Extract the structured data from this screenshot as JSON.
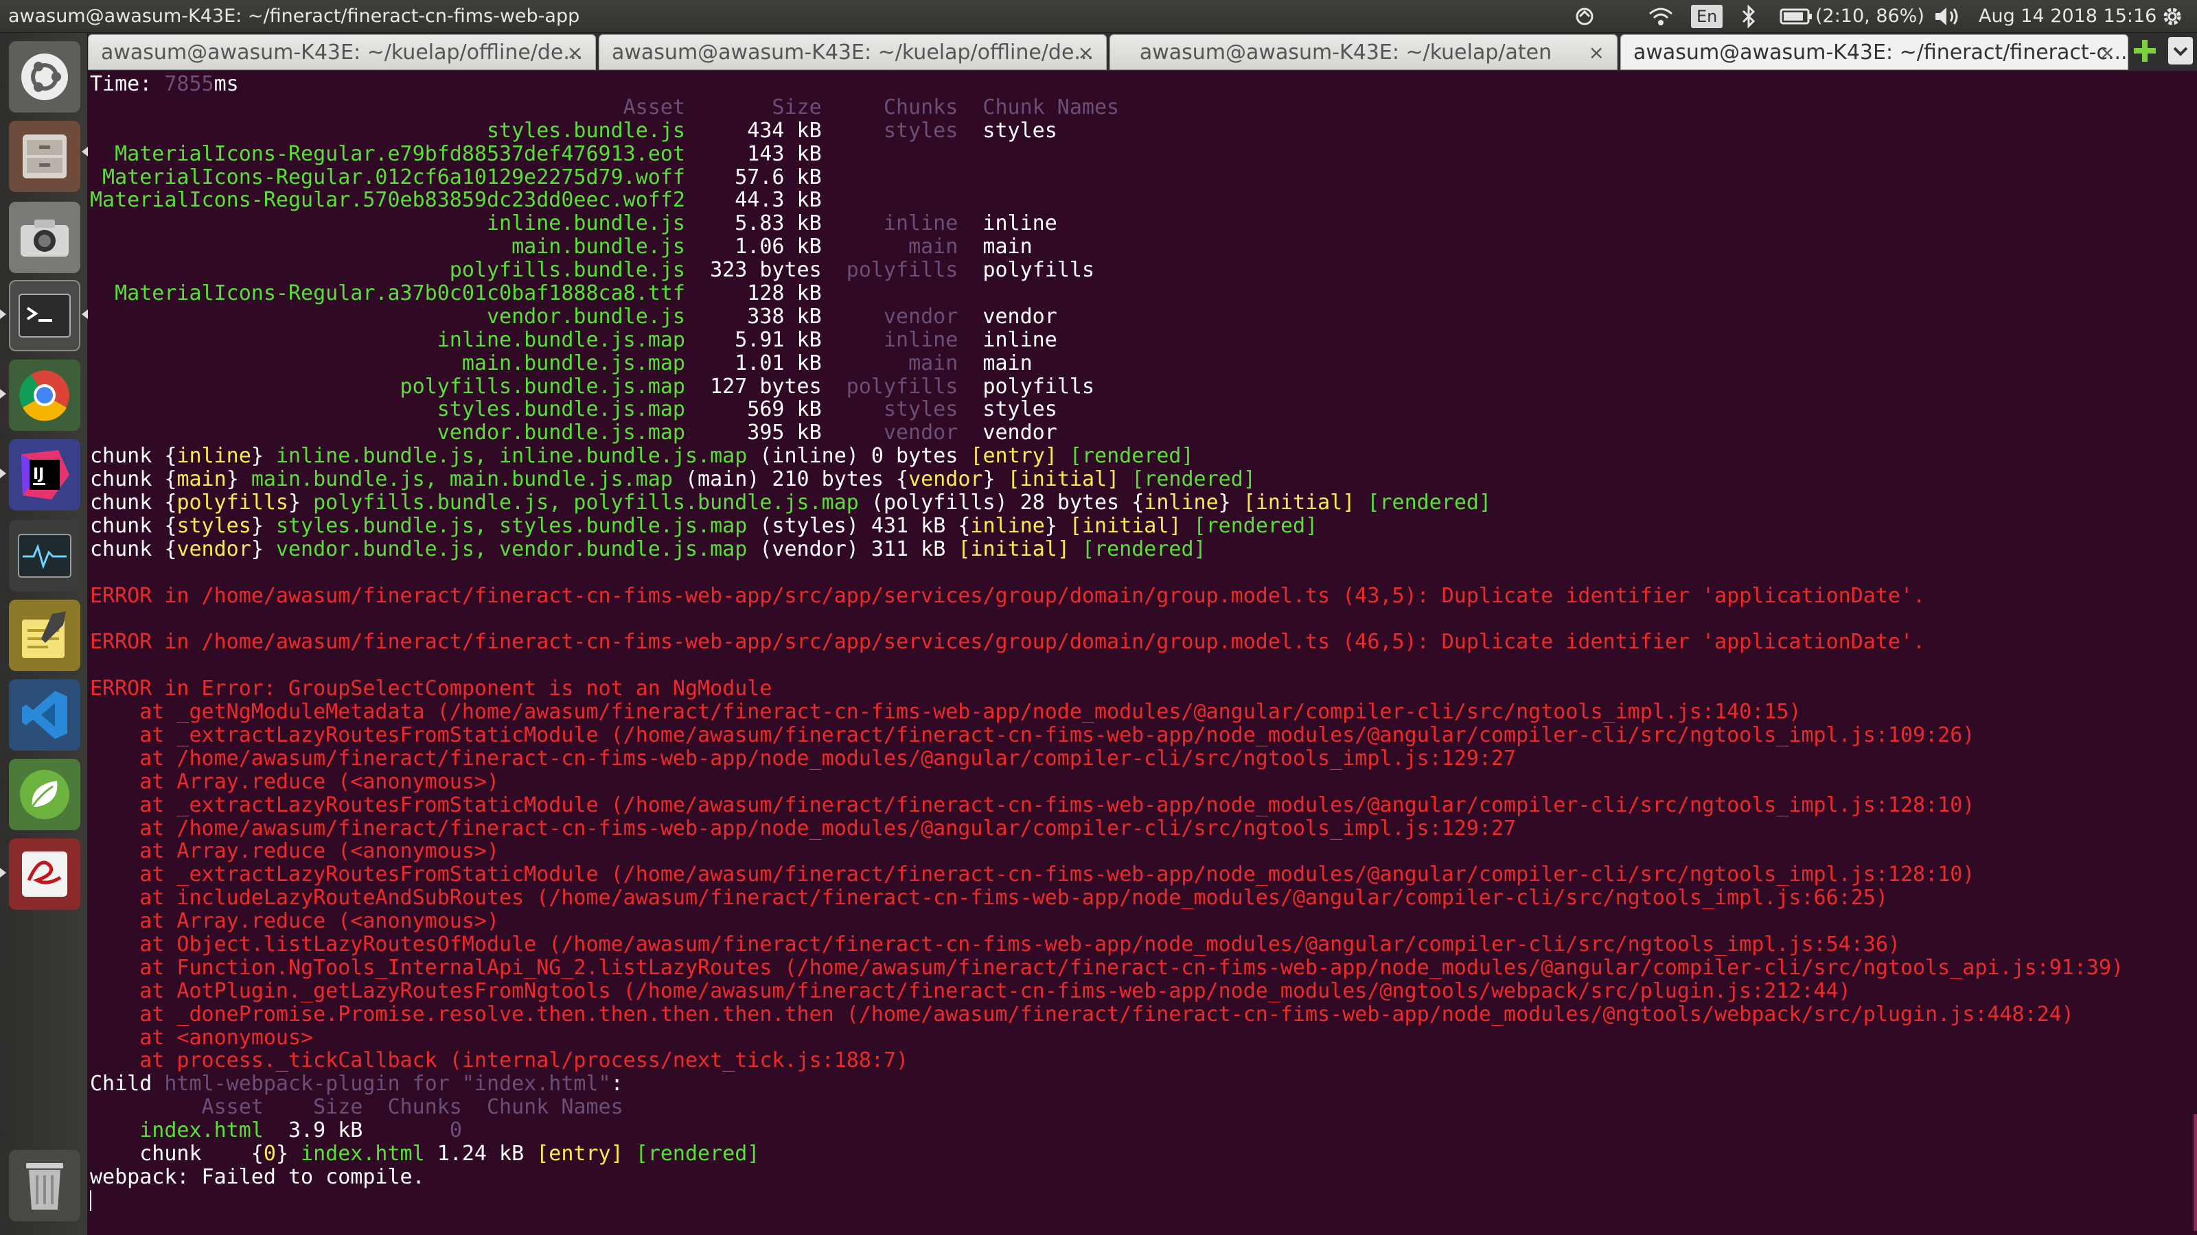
{
  "topbar": {
    "window_title": "awasum@awasum-K43E: ~/fineract/fineract-cn-fims-web-app",
    "keyboard": "En",
    "battery": "(2:10, 86%)",
    "datetime": "Aug 14 2018 15:16"
  },
  "launcher": {
    "items": [
      "ubuntu-dash",
      "files",
      "camera",
      "terminal",
      "chrome",
      "intellij-idea",
      "system-monitor",
      "text-editor",
      "vscode",
      "spring-tool-suite",
      "reader",
      "trash"
    ]
  },
  "tabs": [
    {
      "label": "awasum@awasum-K43E: ~/kuelap/offline/de..."
    },
    {
      "label": "awasum@awasum-K43E: ~/kuelap/offline/de..."
    },
    {
      "label": "awasum@awasum-K43E: ~/kuelap/aten"
    },
    {
      "label": "awasum@awasum-K43E: ~/fineract/fineract-c..."
    }
  ],
  "terminal": {
    "lines": [
      [
        [
          "w",
          "Time: "
        ],
        [
          "dim",
          "7855"
        ],
        [
          "w",
          "ms"
        ]
      ],
      [
        [
          "dim",
          "                                           Asset       Size     Chunks  Chunk Names"
        ]
      ],
      [
        [
          "g",
          "                                styles.bundle.js"
        ],
        [
          "w",
          "     434 kB     "
        ],
        [
          "dim",
          "styles"
        ],
        [
          "w",
          "  styles"
        ]
      ],
      [
        [
          "g",
          "  MaterialIcons-Regular.e79bfd88537def476913.eot"
        ],
        [
          "w",
          "     143 kB"
        ]
      ],
      [
        [
          "g",
          " MaterialIcons-Regular.012cf6a10129e2275d79.woff"
        ],
        [
          "w",
          "    57.6 kB"
        ]
      ],
      [
        [
          "g",
          "MaterialIcons-Regular.570eb83859dc23dd0eec.woff2"
        ],
        [
          "w",
          "    44.3 kB"
        ]
      ],
      [
        [
          "g",
          "                                inline.bundle.js"
        ],
        [
          "w",
          "    5.83 kB     "
        ],
        [
          "dim",
          "inline"
        ],
        [
          "w",
          "  inline"
        ]
      ],
      [
        [
          "g",
          "                                  main.bundle.js"
        ],
        [
          "w",
          "    1.06 kB       "
        ],
        [
          "dim",
          "main"
        ],
        [
          "w",
          "  main"
        ]
      ],
      [
        [
          "g",
          "                             polyfills.bundle.js"
        ],
        [
          "w",
          "  323 bytes  "
        ],
        [
          "dim",
          "polyfills"
        ],
        [
          "w",
          "  polyfills"
        ]
      ],
      [
        [
          "g",
          "  MaterialIcons-Regular.a37b0c01c0baf1888ca8.ttf"
        ],
        [
          "w",
          "     128 kB"
        ]
      ],
      [
        [
          "g",
          "                                vendor.bundle.js"
        ],
        [
          "w",
          "     338 kB     "
        ],
        [
          "dim",
          "vendor"
        ],
        [
          "w",
          "  vendor"
        ]
      ],
      [
        [
          "g",
          "                            inline.bundle.js.map"
        ],
        [
          "w",
          "    5.91 kB     "
        ],
        [
          "dim",
          "inline"
        ],
        [
          "w",
          "  inline"
        ]
      ],
      [
        [
          "g",
          "                              main.bundle.js.map"
        ],
        [
          "w",
          "    1.01 kB       "
        ],
        [
          "dim",
          "main"
        ],
        [
          "w",
          "  main"
        ]
      ],
      [
        [
          "g",
          "                         polyfills.bundle.js.map"
        ],
        [
          "w",
          "  127 bytes  "
        ],
        [
          "dim",
          "polyfills"
        ],
        [
          "w",
          "  polyfills"
        ]
      ],
      [
        [
          "g",
          "                            styles.bundle.js.map"
        ],
        [
          "w",
          "     569 kB     "
        ],
        [
          "dim",
          "styles"
        ],
        [
          "w",
          "  styles"
        ]
      ],
      [
        [
          "g",
          "                            vendor.bundle.js.map"
        ],
        [
          "w",
          "     395 kB     "
        ],
        [
          "dim",
          "vendor"
        ],
        [
          "w",
          "  vendor"
        ]
      ],
      [
        [
          "w",
          "chunk {"
        ],
        [
          "y",
          "inline"
        ],
        [
          "w",
          "} "
        ],
        [
          "g",
          "inline.bundle.js, inline.bundle.js.map"
        ],
        [
          "w",
          " (inline) 0 bytes "
        ],
        [
          "y",
          "[entry]"
        ],
        [
          "w",
          " "
        ],
        [
          "g",
          "[rendered]"
        ]
      ],
      [
        [
          "w",
          "chunk {"
        ],
        [
          "y",
          "main"
        ],
        [
          "w",
          "} "
        ],
        [
          "g",
          "main.bundle.js, main.bundle.js.map"
        ],
        [
          "w",
          " (main) 210 bytes {"
        ],
        [
          "y",
          "vendor"
        ],
        [
          "w",
          "} "
        ],
        [
          "y",
          "[initial]"
        ],
        [
          "w",
          " "
        ],
        [
          "g",
          "[rendered]"
        ]
      ],
      [
        [
          "w",
          "chunk {"
        ],
        [
          "y",
          "polyfills"
        ],
        [
          "w",
          "} "
        ],
        [
          "g",
          "polyfills.bundle.js, polyfills.bundle.js.map"
        ],
        [
          "w",
          " (polyfills) 28 bytes {"
        ],
        [
          "y",
          "inline"
        ],
        [
          "w",
          "} "
        ],
        [
          "y",
          "[initial]"
        ],
        [
          "w",
          " "
        ],
        [
          "g",
          "[rendered]"
        ]
      ],
      [
        [
          "w",
          "chunk {"
        ],
        [
          "y",
          "styles"
        ],
        [
          "w",
          "} "
        ],
        [
          "g",
          "styles.bundle.js, styles.bundle.js.map"
        ],
        [
          "w",
          " (styles) 431 kB {"
        ],
        [
          "y",
          "inline"
        ],
        [
          "w",
          "} "
        ],
        [
          "y",
          "[initial]"
        ],
        [
          "w",
          " "
        ],
        [
          "g",
          "[rendered]"
        ]
      ],
      [
        [
          "w",
          "chunk {"
        ],
        [
          "y",
          "vendor"
        ],
        [
          "w",
          "} "
        ],
        [
          "g",
          "vendor.bundle.js, vendor.bundle.js.map"
        ],
        [
          "w",
          " (vendor) 311 kB "
        ],
        [
          "y",
          "[initial]"
        ],
        [
          "w",
          " "
        ],
        [
          "g",
          "[rendered]"
        ]
      ],
      [
        [
          "w",
          ""
        ]
      ],
      [
        [
          "r",
          "ERROR in /home/awasum/fineract/fineract-cn-fims-web-app/src/app/services/group/domain/group.model.ts (43,5): Duplicate identifier 'applicationDate'."
        ]
      ],
      [
        [
          "w",
          ""
        ]
      ],
      [
        [
          "r",
          "ERROR in /home/awasum/fineract/fineract-cn-fims-web-app/src/app/services/group/domain/group.model.ts (46,5): Duplicate identifier 'applicationDate'."
        ]
      ],
      [
        [
          "w",
          ""
        ]
      ],
      [
        [
          "r",
          "ERROR in Error: GroupSelectComponent is not an NgModule"
        ]
      ],
      [
        [
          "r",
          "    at _getNgModuleMetadata (/home/awasum/fineract/fineract-cn-fims-web-app/node_modules/@angular/compiler-cli/src/ngtools_impl.js:140:15)"
        ]
      ],
      [
        [
          "r",
          "    at _extractLazyRoutesFromStaticModule (/home/awasum/fineract/fineract-cn-fims-web-app/node_modules/@angular/compiler-cli/src/ngtools_impl.js:109:26)"
        ]
      ],
      [
        [
          "r",
          "    at /home/awasum/fineract/fineract-cn-fims-web-app/node_modules/@angular/compiler-cli/src/ngtools_impl.js:129:27"
        ]
      ],
      [
        [
          "r",
          "    at Array.reduce (<anonymous>)"
        ]
      ],
      [
        [
          "r",
          "    at _extractLazyRoutesFromStaticModule (/home/awasum/fineract/fineract-cn-fims-web-app/node_modules/@angular/compiler-cli/src/ngtools_impl.js:128:10)"
        ]
      ],
      [
        [
          "r",
          "    at /home/awasum/fineract/fineract-cn-fims-web-app/node_modules/@angular/compiler-cli/src/ngtools_impl.js:129:27"
        ]
      ],
      [
        [
          "r",
          "    at Array.reduce (<anonymous>)"
        ]
      ],
      [
        [
          "r",
          "    at _extractLazyRoutesFromStaticModule (/home/awasum/fineract/fineract-cn-fims-web-app/node_modules/@angular/compiler-cli/src/ngtools_impl.js:128:10)"
        ]
      ],
      [
        [
          "r",
          "    at includeLazyRouteAndSubRoutes (/home/awasum/fineract/fineract-cn-fims-web-app/node_modules/@angular/compiler-cli/src/ngtools_impl.js:66:25)"
        ]
      ],
      [
        [
          "r",
          "    at Array.reduce (<anonymous>)"
        ]
      ],
      [
        [
          "r",
          "    at Object.listLazyRoutesOfModule (/home/awasum/fineract/fineract-cn-fims-web-app/node_modules/@angular/compiler-cli/src/ngtools_impl.js:54:36)"
        ]
      ],
      [
        [
          "r",
          "    at Function.NgTools_InternalApi_NG_2.listLazyRoutes (/home/awasum/fineract/fineract-cn-fims-web-app/node_modules/@angular/compiler-cli/src/ngtools_api.js:91:39)"
        ]
      ],
      [
        [
          "r",
          "    at AotPlugin._getLazyRoutesFromNgtools (/home/awasum/fineract/fineract-cn-fims-web-app/node_modules/@ngtools/webpack/src/plugin.js:212:44)"
        ]
      ],
      [
        [
          "r",
          "    at _donePromise.Promise.resolve.then.then.then.then.then (/home/awasum/fineract/fineract-cn-fims-web-app/node_modules/@ngtools/webpack/src/plugin.js:448:24)"
        ]
      ],
      [
        [
          "r",
          "    at <anonymous>"
        ]
      ],
      [
        [
          "r",
          "    at process._tickCallback (internal/process/next_tick.js:188:7)"
        ]
      ],
      [
        [
          "w",
          "Child "
        ],
        [
          "dim",
          "html-webpack-plugin for \"index.html\""
        ],
        [
          "w",
          ":"
        ]
      ],
      [
        [
          "dim",
          "         Asset    Size  Chunks  Chunk Names"
        ]
      ],
      [
        [
          "g",
          "    index.html"
        ],
        [
          "w",
          "  3.9 kB       "
        ],
        [
          "dim",
          "0"
        ]
      ],
      [
        [
          "w",
          "    chunk    {"
        ],
        [
          "y",
          "0"
        ],
        [
          "w",
          "} "
        ],
        [
          "g",
          "index.html"
        ],
        [
          "w",
          " 1.24 kB "
        ],
        [
          "y",
          "[entry]"
        ],
        [
          "w",
          " "
        ],
        [
          "g",
          "[rendered]"
        ]
      ],
      [
        [
          "w",
          "webpack: Failed to compile."
        ]
      ]
    ]
  },
  "colors": {
    "terminal_bg": "#300a24",
    "text_white": "#ffffff",
    "text_green": "#58e036",
    "text_yellow": "#fce94f",
    "text_red": "#ef2929",
    "text_dim": "#6a4f78"
  }
}
